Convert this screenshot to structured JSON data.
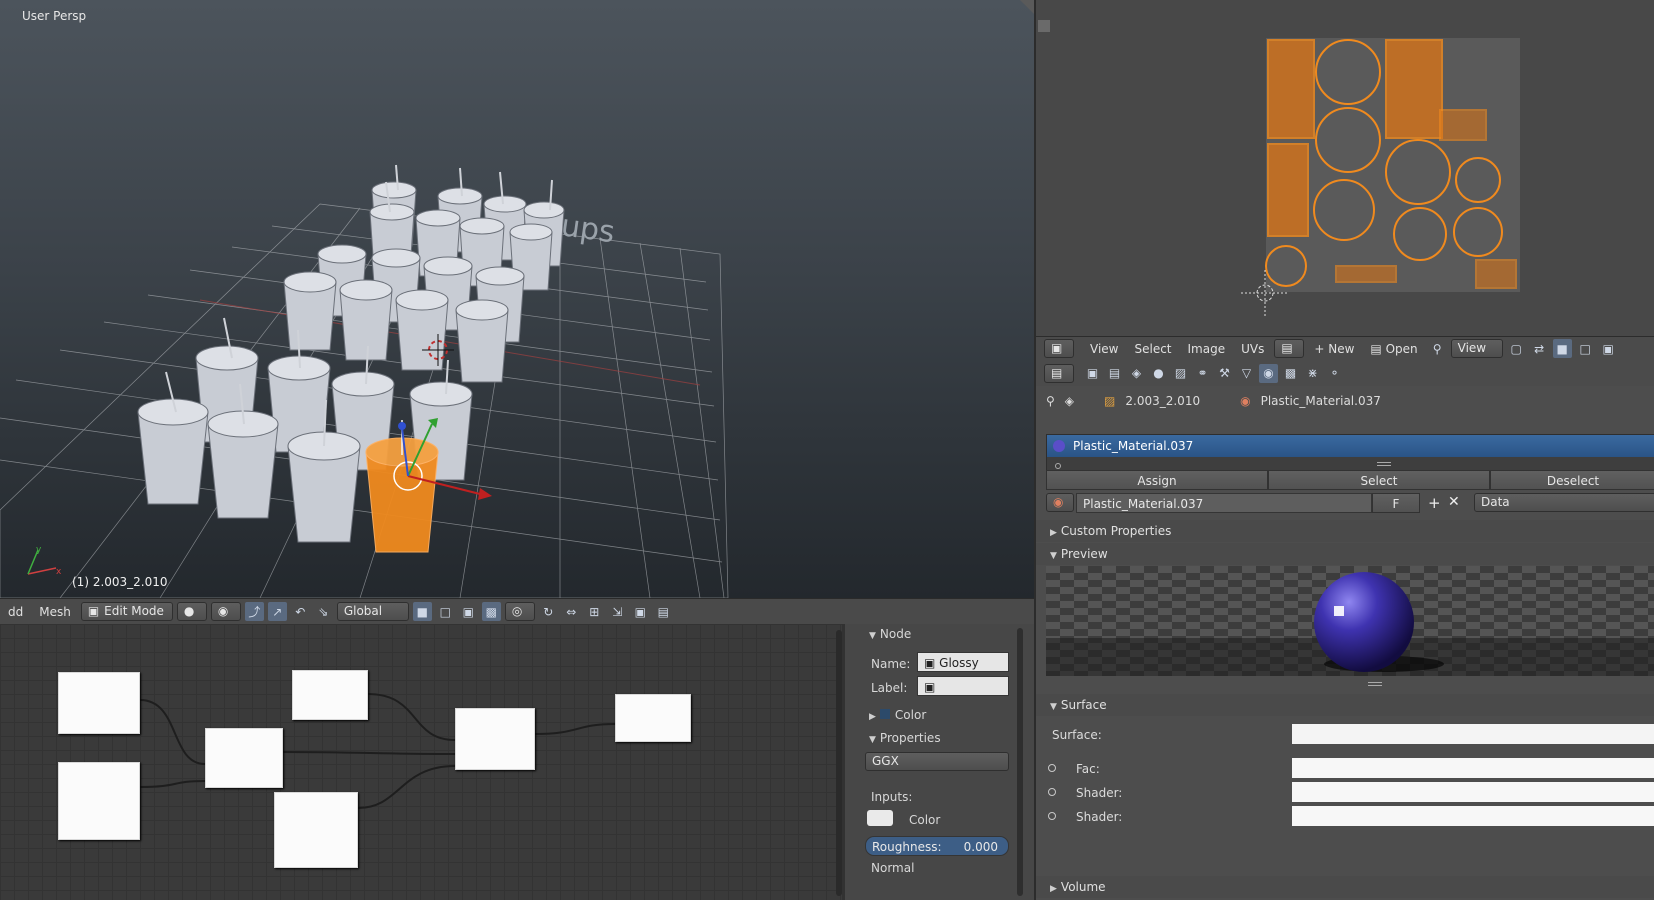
{
  "viewport": {
    "label": "User Persp",
    "object_label": "(1) 2.003_2.010",
    "scene_text": "ups"
  },
  "header3d": {
    "add_label": "dd",
    "mesh_label": "Mesh",
    "mode_label": "Edit Mode",
    "orientation_label": "Global"
  },
  "uv_header": {
    "view": "View",
    "select": "Select",
    "image": "Image",
    "uvs": "UVs",
    "new": "New",
    "open": "Open",
    "view_menu": "View"
  },
  "properties": {
    "breadcrumb_object": "2.003_2.010",
    "breadcrumb_material": "Plastic_Material.037",
    "slot_name": "Plastic_Material.037",
    "assign": "Assign",
    "select": "Select",
    "deselect": "Deselect",
    "material_field": "Plastic_Material.037",
    "fake_user": "F",
    "link": "Data",
    "custom_properties": "Custom Properties",
    "preview": "Preview",
    "surface_panel": "Surface",
    "surface_label": "Surface:",
    "fac_label": "Fac:",
    "shader1_label": "Shader:",
    "shader2_label": "Shader:",
    "volume": "Volume"
  },
  "node_panel": {
    "node_header": "Node",
    "name_label": "Name:",
    "name_value": "Glossy BSD...",
    "label_label": "Label:",
    "color_header": "Color",
    "properties_header": "Properties",
    "distribution": "GGX",
    "inputs_label": "Inputs:",
    "color_label": "Color",
    "roughness_label": "Roughness:",
    "roughness_value": "0.000",
    "normal_label": "Normal"
  },
  "colors": {
    "accent_blue": "#2f5d8c",
    "selection_orange": "#f08a1e",
    "material_purple": "#4a3fb0"
  }
}
